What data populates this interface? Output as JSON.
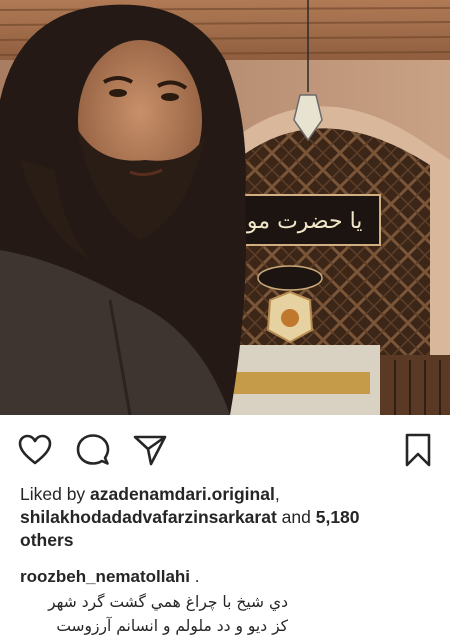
{
  "post": {
    "photo": {
      "description_icon": "photo",
      "plaque_text": "یا حضرت مولانا"
    },
    "actions": {
      "like_icon": "heart-icon",
      "comment_icon": "comment-icon",
      "share_icon": "share-icon",
      "save_icon": "bookmark-icon"
    },
    "likes": {
      "prefix": "Liked by ",
      "user1": "azadenamdari.original",
      "separator": ",",
      "user2": "shilakhodadadvafarzinsarkarat",
      "and_text": " and ",
      "count": "5,180",
      "suffix": "others"
    },
    "caption": {
      "username": "roozbeh_nematollahi",
      "dot": " .",
      "line1": "دي شيخ با چراغ همي گشت گرد شهر",
      "line2": "كز ديو و دد ملولم و انسانم آرزوست"
    }
  },
  "colors": {
    "text": "#262626",
    "background": "#ffffff"
  }
}
